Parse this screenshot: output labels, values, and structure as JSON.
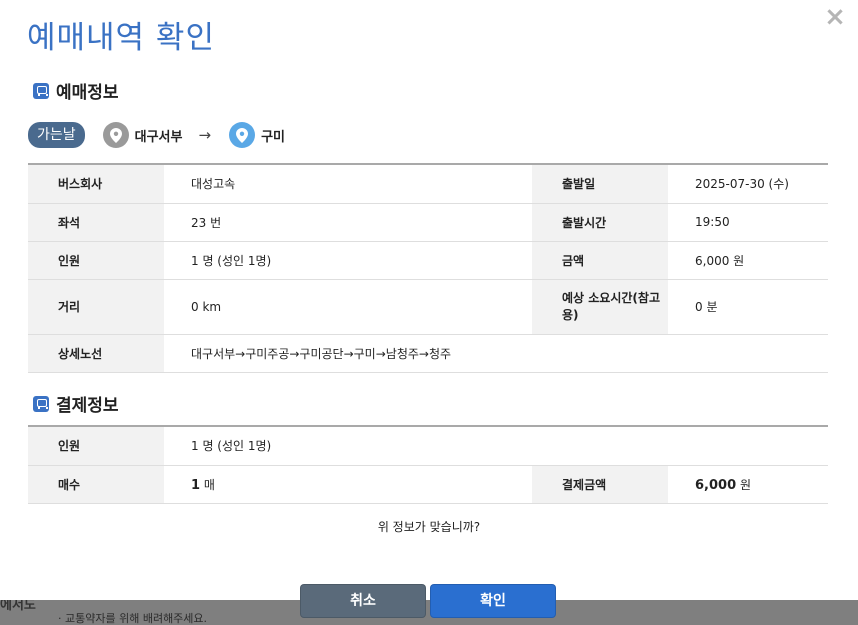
{
  "modal": {
    "title": "예매내역 확인",
    "close_symbol": "×"
  },
  "reservation": {
    "section_title": "예매정보",
    "direction_badge": "가는날",
    "origin": "대구서부",
    "arrow": "→",
    "destination": "구미",
    "rows": {
      "company_label": "버스회사",
      "company_value": "대성고속",
      "date_label": "출발일",
      "date_value": "2025-07-30 (수)",
      "seat_label": "좌석",
      "seat_value": "23 번",
      "time_label": "출발시간",
      "time_value": "19:50",
      "people_label": "인원",
      "people_value": "1 명 (성인 1명)",
      "amount_label": "금액",
      "amount_value": "6,000 원",
      "distance_label": "거리",
      "distance_value": "0 km",
      "duration_label": "예상 소요시간(참고용)",
      "duration_value": "0 분",
      "route_label": "상세노선",
      "route_value": "대구서부→구미주공→구미공단→구미→남청주→청주"
    }
  },
  "payment": {
    "section_title": "결제정보",
    "people_label": "인원",
    "people_value": "1 명 (성인 1명)",
    "count_label": "매수",
    "count_number": "1",
    "count_unit": "매",
    "total_label": "결제금액",
    "total_number": "6,000",
    "total_unit": "원"
  },
  "question": "위 정보가 맞습니까?",
  "buttons": {
    "cancel": "취소",
    "ok": "확인"
  },
  "background": {
    "note": "· 교통약자를 위해 배려해주세요.",
    "left_fragment": "에서도"
  },
  "colors": {
    "title": "#3a72c4",
    "badge": "#4a6a8e",
    "pin_origin": "#9a9a9a",
    "pin_destination": "#5aa8e6",
    "cancel_button": "#5a6a7a",
    "ok_button": "#2a6fd0"
  },
  "icons": {
    "section": "bus-icon",
    "place": "map-pin-icon",
    "close": "close-icon",
    "route_arrow": "arrow-right-icon"
  }
}
